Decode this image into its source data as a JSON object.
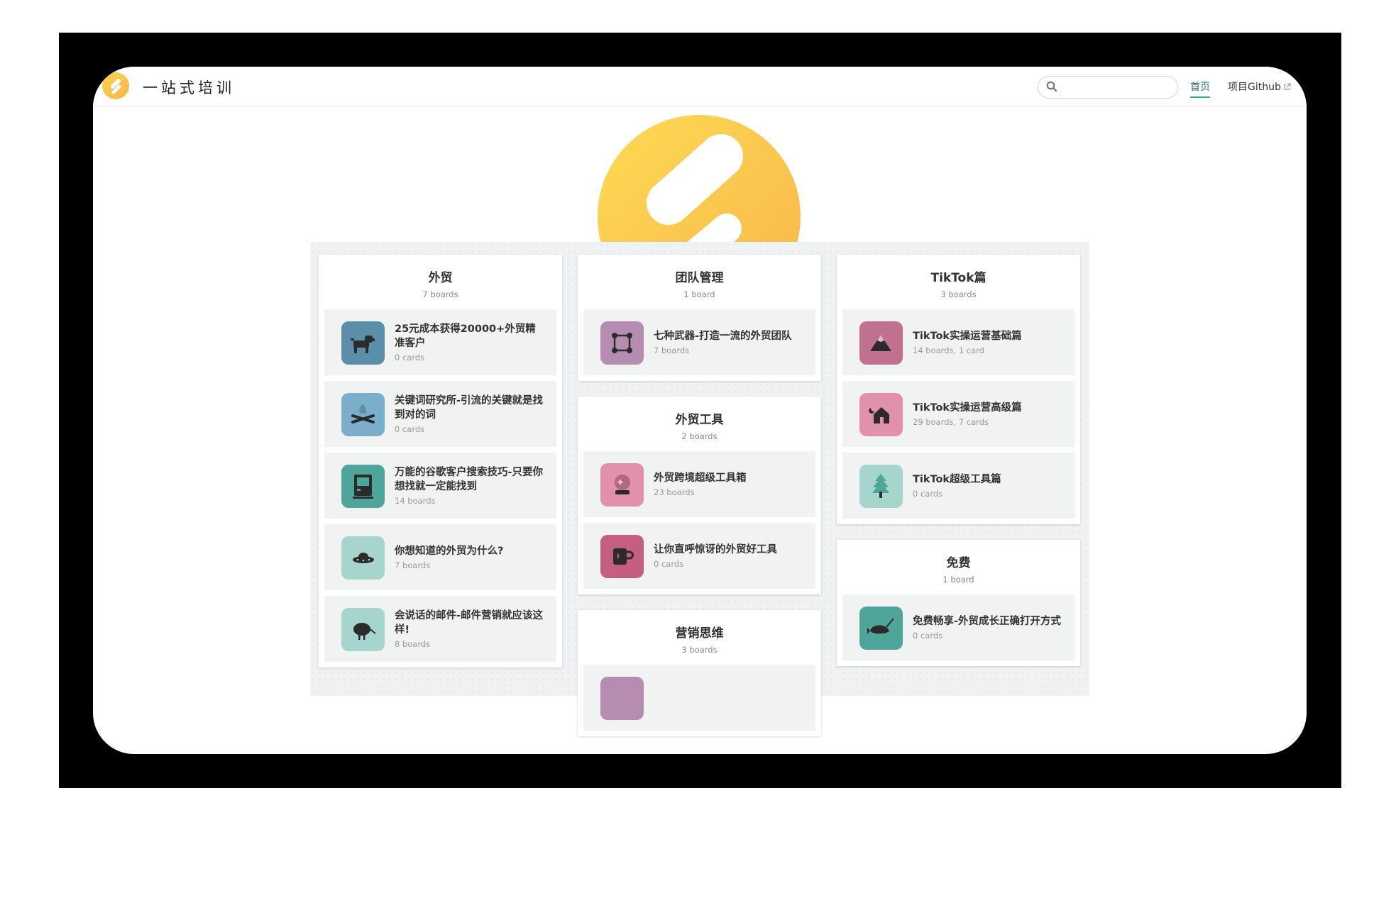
{
  "header": {
    "site_title": "一站式培训",
    "search_placeholder": "",
    "nav_home": "首页",
    "nav_github": "项目Github"
  },
  "columns": [
    {
      "panels": [
        {
          "title": "外贸",
          "subtitle": "7 boards",
          "cards": [
            {
              "title": "25元成本获得20000+外贸精准客户",
              "count": "0 cards",
              "icon": "dog-icon",
              "color": "#5b8ea8"
            },
            {
              "title": "关键词研究所-引流的关键就是找到对的词",
              "count": "0 cards",
              "icon": "campfire-icon",
              "color": "#7aaecb"
            },
            {
              "title": "万能的谷歌客户搜索技巧-只要你想找就一定能找到",
              "count": "14 boards",
              "icon": "computer-icon",
              "color": "#4ea69a"
            },
            {
              "title": "你想知道的外贸为什么?",
              "count": "7 boards",
              "icon": "ufo-icon",
              "color": "#a6d5cd"
            },
            {
              "title": "会说话的邮件-邮件营销就应该这样!",
              "count": "8 boards",
              "icon": "kiwi-bird-icon",
              "color": "#a6d5cd"
            }
          ]
        }
      ]
    },
    {
      "panels": [
        {
          "title": "团队管理",
          "subtitle": "1 board",
          "cards": [
            {
              "title": "七种武器-打造一流的外贸团队",
              "count": "7 boards",
              "icon": "vector-square-icon",
              "color": "#b68cb0"
            }
          ]
        },
        {
          "title": "外贸工具",
          "subtitle": "2 boards",
          "cards": [
            {
              "title": "外贸跨境超级工具箱",
              "count": "23 boards",
              "icon": "crystal-ball-icon",
              "color": "#e291ac"
            },
            {
              "title": "让你直呼惊讶的外贸好工具",
              "count": "0 cards",
              "icon": "mug-icon",
              "color": "#c45e83"
            }
          ]
        },
        {
          "title": "营销思维",
          "subtitle": "3 boards",
          "cards": [
            {
              "title": "",
              "count": "",
              "icon": "board-icon",
              "color": "#b68cb0"
            }
          ]
        }
      ]
    },
    {
      "panels": [
        {
          "title": "TikTok篇",
          "subtitle": "3 boards",
          "cards": [
            {
              "title": "TikTok实操运营基础篇",
              "count": "14 boards, 1 card",
              "icon": "mountain-icon",
              "color": "#c2708f"
            },
            {
              "title": "TikTok实操运营高级篇",
              "count": "29 boards, 7 cards",
              "icon": "house-night-icon",
              "color": "#e291ac"
            },
            {
              "title": "TikTok超级工具篇",
              "count": "0 cards",
              "icon": "tree-icon",
              "color": "#a6d5cd"
            }
          ]
        },
        {
          "title": "免费",
          "subtitle": "1 board",
          "cards": [
            {
              "title": "免费畅享-外贸成长正确打开方式",
              "count": "0 cards",
              "icon": "narwhal-icon",
              "color": "#4ea69a"
            }
          ]
        }
      ]
    }
  ]
}
